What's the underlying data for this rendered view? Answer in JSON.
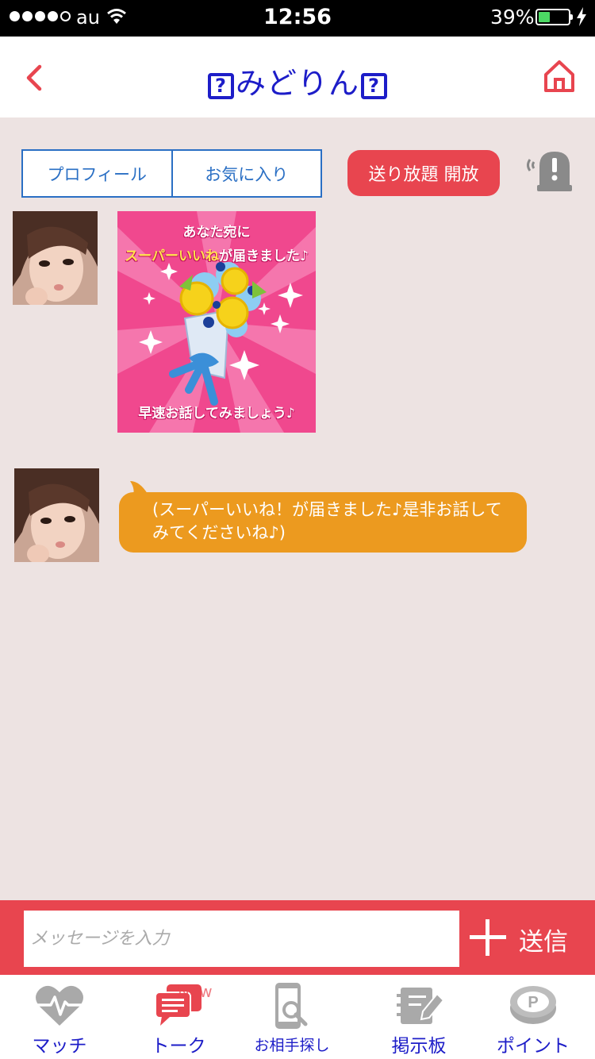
{
  "status_bar": {
    "carrier": "au",
    "time": "12:56",
    "battery_percent": "39%",
    "battery_level": 0.39,
    "signal_bars_filled": 4
  },
  "header": {
    "title": "みどりん",
    "title_icon_glyph": "?",
    "back_icon": "chevron-left-icon",
    "home_icon": "home-icon"
  },
  "actions": {
    "profile_label": "プロフィール",
    "favorite_label": "お気に入り",
    "unlimited_label": "送り放題 開放",
    "alert_icon": "alert-icon"
  },
  "messages": {
    "stamp": {
      "line1": "あなた宛に",
      "line2_highlight": "スーパーいいね",
      "line2_rest": "が届きました♪",
      "line3": "早速お話してみましょう♪"
    },
    "text_bubble": "(スーパーいいね！が届きました♪是非お話してみてくださいね♪)"
  },
  "input_bar": {
    "placeholder": "メッセージを入力",
    "value": "",
    "send_label": "送信"
  },
  "tab_bar": {
    "new_badge": "New",
    "items": [
      {
        "label": "マッチ",
        "icon": "heartbeat-icon"
      },
      {
        "label": "トーク",
        "icon": "chat-icon"
      },
      {
        "label": "お相手探し",
        "icon": "phone-search-icon"
      },
      {
        "label": "掲示板",
        "icon": "board-icon"
      },
      {
        "label": "ポイント",
        "icon": "point-coin-icon"
      }
    ]
  },
  "colors": {
    "accent_red": "#e8454f",
    "title_blue": "#1d1dc8",
    "link_blue": "#2a6fc4",
    "bubble_orange": "#ec9a1f",
    "chat_background": "#ede3e2",
    "stamp_pink": "#f0488e"
  }
}
